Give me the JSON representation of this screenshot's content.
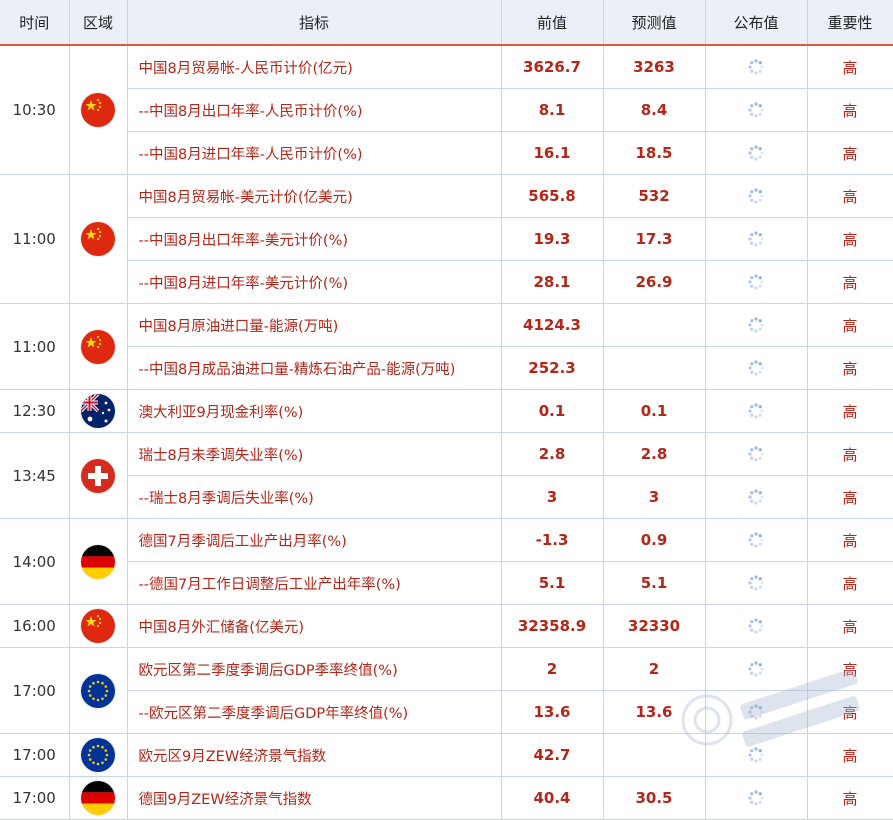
{
  "header": {
    "time": "时间",
    "region": "区域",
    "indicator": "指标",
    "previous": "前值",
    "forecast": "预测值",
    "actual": "公布值",
    "importance": "重要性"
  },
  "icons": {
    "pending": "loading-spinner-icon",
    "flags": {
      "cn": "china-flag-icon",
      "au": "australia-flag-icon",
      "ch": "switzerland-flag-icon",
      "de": "germany-flag-icon",
      "eu": "eu-flag-icon"
    }
  },
  "colors": {
    "accent_red": "#b4261a",
    "header_bg": "#ebf0f8",
    "header_line": "#e05a3a",
    "grid": "#c8d6ea"
  },
  "groups": [
    {
      "time": "10:30",
      "flag": "cn",
      "rows": [
        {
          "indicator": "中国8月贸易帐-人民币计价(亿元)",
          "previous": "3626.7",
          "forecast": "3263",
          "importance": "高"
        },
        {
          "indicator": "--中国8月出口年率-人民币计价(%)",
          "previous": "8.1",
          "forecast": "8.4",
          "importance": "高"
        },
        {
          "indicator": "--中国8月进口年率-人民币计价(%)",
          "previous": "16.1",
          "forecast": "18.5",
          "importance": "高"
        }
      ]
    },
    {
      "time": "11:00",
      "flag": "cn",
      "rows": [
        {
          "indicator": "中国8月贸易帐-美元计价(亿美元)",
          "previous": "565.8",
          "forecast": "532",
          "importance": "高"
        },
        {
          "indicator": "--中国8月出口年率-美元计价(%)",
          "previous": "19.3",
          "forecast": "17.3",
          "importance": "高"
        },
        {
          "indicator": "--中国8月进口年率-美元计价(%)",
          "previous": "28.1",
          "forecast": "26.9",
          "importance": "高"
        }
      ]
    },
    {
      "time": "11:00",
      "flag": "cn",
      "rows": [
        {
          "indicator": "中国8月原油进口量-能源(万吨)",
          "previous": "4124.3",
          "forecast": "",
          "importance": "高"
        },
        {
          "indicator": "--中国8月成品油进口量-精炼石油产品-能源(万吨)",
          "previous": "252.3",
          "forecast": "",
          "importance": "高"
        }
      ]
    },
    {
      "time": "12:30",
      "flag": "au",
      "rows": [
        {
          "indicator": "澳大利亚9月现金利率(%)",
          "previous": "0.1",
          "forecast": "0.1",
          "importance": "高"
        }
      ]
    },
    {
      "time": "13:45",
      "flag": "ch",
      "rows": [
        {
          "indicator": "瑞士8月未季调失业率(%)",
          "previous": "2.8",
          "forecast": "2.8",
          "importance": "高"
        },
        {
          "indicator": "--瑞士8月季调后失业率(%)",
          "previous": "3",
          "forecast": "3",
          "importance": "高"
        }
      ]
    },
    {
      "time": "14:00",
      "flag": "de",
      "rows": [
        {
          "indicator": "德国7月季调后工业产出月率(%)",
          "previous": "-1.3",
          "forecast": "0.9",
          "importance": "高"
        },
        {
          "indicator": "--德国7月工作日调整后工业产出年率(%)",
          "previous": "5.1",
          "forecast": "5.1",
          "importance": "高"
        }
      ]
    },
    {
      "time": "16:00",
      "flag": "cn",
      "rows": [
        {
          "indicator": "中国8月外汇储备(亿美元)",
          "previous": "32358.9",
          "forecast": "32330",
          "importance": "高"
        }
      ]
    },
    {
      "time": "17:00",
      "flag": "eu",
      "rows": [
        {
          "indicator": "欧元区第二季度季调后GDP季率终值(%)",
          "previous": "2",
          "forecast": "2",
          "importance": "高"
        },
        {
          "indicator": "--欧元区第二季度季调后GDP年率终值(%)",
          "previous": "13.6",
          "forecast": "13.6",
          "importance": "高"
        }
      ]
    },
    {
      "time": "17:00",
      "flag": "eu",
      "rows": [
        {
          "indicator": "欧元区9月ZEW经济景气指数",
          "previous": "42.7",
          "forecast": "",
          "importance": "高"
        }
      ]
    },
    {
      "time": "17:00",
      "flag": "de",
      "rows": [
        {
          "indicator": "德国9月ZEW经济景气指数",
          "previous": "40.4",
          "forecast": "30.5",
          "importance": "高"
        }
      ]
    }
  ]
}
